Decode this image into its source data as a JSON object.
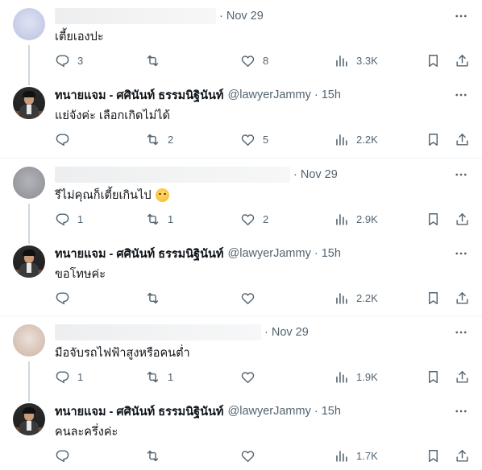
{
  "threads": [
    {
      "reply": {
        "time": "Nov 29",
        "text": "เตี้ยเองปะ",
        "stats": {
          "replies": "3",
          "retweets": "",
          "likes": "8",
          "views": "3.3K"
        }
      },
      "answer": {
        "name": "ทนายแจม - ศศินันท์ ธรรมนิฐินันท์",
        "handle": "@lawyerJammy",
        "time": "15h",
        "text": "แย่จังค่ะ เลือกเกิดไม่ได้",
        "stats": {
          "replies": "",
          "retweets": "2",
          "likes": "5",
          "views": "2.2K"
        }
      }
    },
    {
      "reply": {
        "time": "Nov 29",
        "text": "รีไม่คุณก็เตี้ยเกินไป",
        "emoji": "face-with-hand-over-mouth",
        "stats": {
          "replies": "1",
          "retweets": "1",
          "likes": "2",
          "views": "2.9K"
        }
      },
      "answer": {
        "name": "ทนายแจม - ศศินันท์ ธรรมนิฐินันท์",
        "handle": "@lawyerJammy",
        "time": "15h",
        "text": "ขอโทษค่ะ",
        "stats": {
          "replies": "",
          "retweets": "",
          "likes": "",
          "views": "2.2K"
        }
      }
    },
    {
      "reply": {
        "time": "Nov 29",
        "text": "มือจับรถไฟฟ้าสูงหรือคนต่ำ",
        "stats": {
          "replies": "1",
          "retweets": "1",
          "likes": "",
          "views": "1.9K"
        }
      },
      "answer": {
        "name": "ทนายแจม - ศศินันท์ ธรรมนิฐินันท์",
        "handle": "@lawyerJammy",
        "time": "15h",
        "text": "คนละครึ่งค่ะ",
        "stats": {
          "replies": "",
          "retweets": "",
          "likes": "",
          "views": "1.7K"
        }
      }
    }
  ],
  "separator": "·",
  "colors": {
    "text": "#0f1419",
    "secondary": "#536471",
    "border": "#eff3f4",
    "thread_line": "#cfd9de"
  },
  "icons": [
    "more-icon",
    "reply-icon",
    "retweet-icon",
    "like-icon",
    "views-icon",
    "bookmark-icon",
    "share-icon"
  ]
}
